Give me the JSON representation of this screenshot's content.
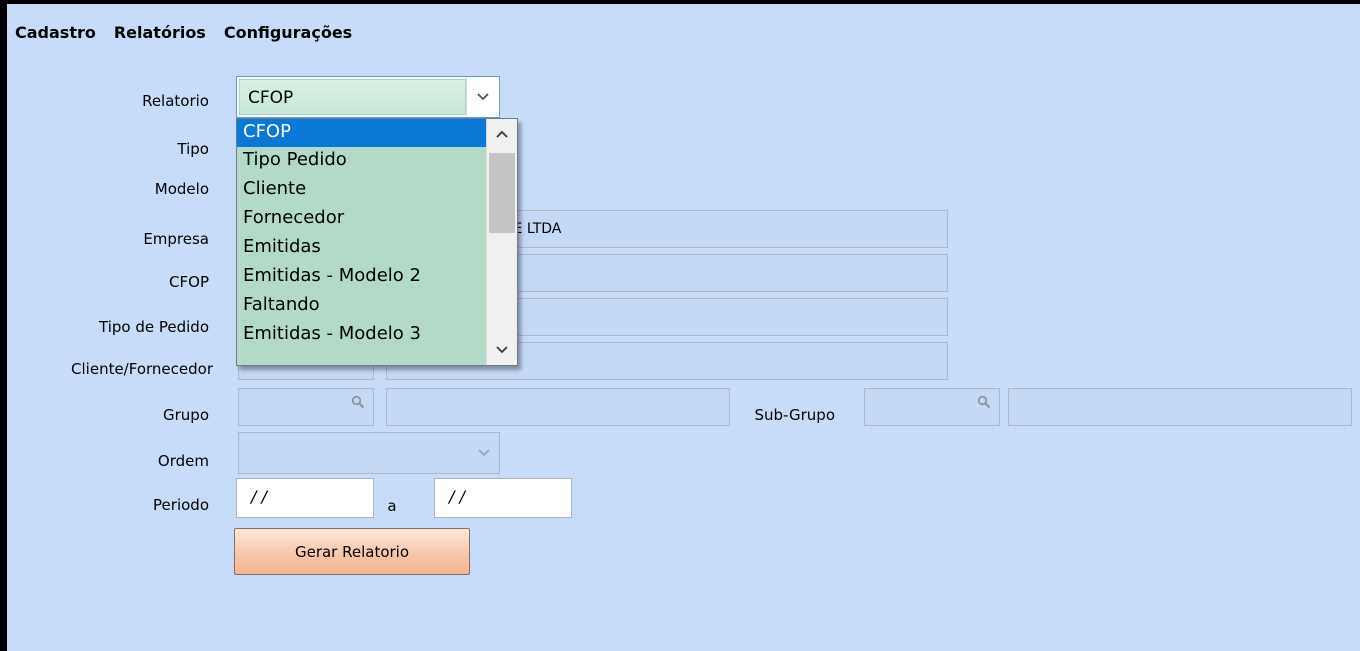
{
  "menu": [
    "Cadastro",
    "Relatórios",
    "Configurações"
  ],
  "labels": {
    "relatorio": "Relatorio",
    "tipo": "Tipo",
    "modelo": "Modelo",
    "empresa": "Empresa",
    "cfop": "CFOP",
    "tipo_pedido": "Tipo de Pedido",
    "cliente_fornecedor": "Cliente/Fornecedor",
    "grupo": "Grupo",
    "sub_grupo": "Sub-Grupo",
    "ordem": "Ordem",
    "periodo": "Periodo",
    "periodo_sep": "a"
  },
  "fields": {
    "relatorio_value": "CFOP",
    "empresa_partial": "TE LTDA",
    "periodo_start": "/ /",
    "periodo_end": "/ /"
  },
  "dropdown": {
    "options": [
      "CFOP",
      "Tipo Pedido",
      "Cliente",
      "Fornecedor",
      "Emitidas",
      "Emitidas - Modelo 2",
      "Faltando",
      "Emitidas - Modelo 3"
    ],
    "selected": "CFOP"
  },
  "buttons": {
    "gerar": "Gerar Relatorio"
  },
  "icons": {
    "lookup": "magnifier-icon",
    "combo": "chevron-down-icon"
  }
}
